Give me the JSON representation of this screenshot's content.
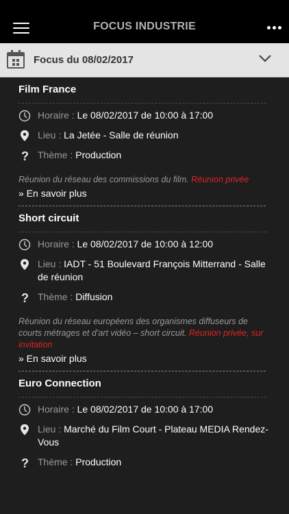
{
  "header": {
    "title": "FOCUS INDUSTRIE",
    "menu_icon": "hamburger-menu-icon",
    "more_icon": "more-dots-icon"
  },
  "datebar": {
    "label": "Focus du 08/02/2017",
    "calendar_icon": "calendar-icon",
    "chevron_icon": "chevron-down-icon"
  },
  "labels": {
    "horaire": "Horaire :",
    "lieu": "Lieu :",
    "theme": "Thème :",
    "more": "» En savoir plus"
  },
  "events": [
    {
      "title": "Film France",
      "horaire": "Le 08/02/2017 de 10:00 à 17:00",
      "lieu": "La Jetée - Salle de réunion",
      "theme": "Production",
      "description": "Réunion du réseau des commissions du film.",
      "private_note": "Réunion privée"
    },
    {
      "title": "Short circuit",
      "horaire": "Le 08/02/2017 de 10:00 à 12:00",
      "lieu": "IADT - 51 Boulevard François Mitterrand - Salle de réunion",
      "theme": "Diffusion",
      "description": "Réunion du réseau européens des organismes diffuseurs de courts métrages et d'art vidéo – short circuit.",
      "private_note": "Réunion privée, sur invitation"
    },
    {
      "title": "Euro Connection",
      "horaire": "Le 08/02/2017 de 10:00 à 17:00",
      "lieu": "Marché du Film Court - Plateau MEDIA Rendez-Vous",
      "theme": "Production"
    }
  ],
  "colors": {
    "background": "#1e1e1e",
    "topbar": "#000000",
    "datebar": "#e4e4e4",
    "private": "#e02424",
    "label_grey": "#999999"
  }
}
